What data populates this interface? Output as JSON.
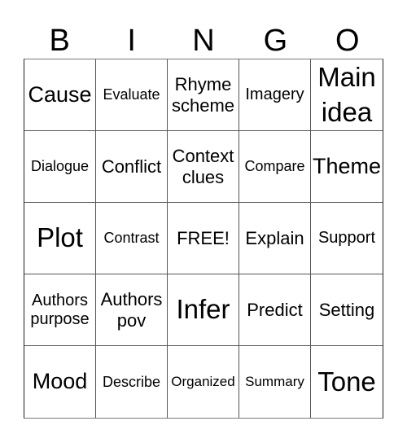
{
  "header": {
    "letters": [
      "B",
      "I",
      "N",
      "G",
      "O"
    ]
  },
  "card": {
    "rows": [
      [
        "Cause",
        "Evaluate",
        "Rhyme scheme",
        "Imagery",
        "Main idea"
      ],
      [
        "Dialogue",
        "Conflict",
        "Context clues",
        "Compare",
        "Theme"
      ],
      [
        "Plot",
        "Contrast",
        "FREE!",
        "Explain",
        "Support"
      ],
      [
        "Authors purpose",
        "Authors pov",
        "Infer",
        "Predict",
        "Setting"
      ],
      [
        "Mood",
        "Describe",
        "Organized",
        "Summary",
        "Tone"
      ]
    ]
  }
}
